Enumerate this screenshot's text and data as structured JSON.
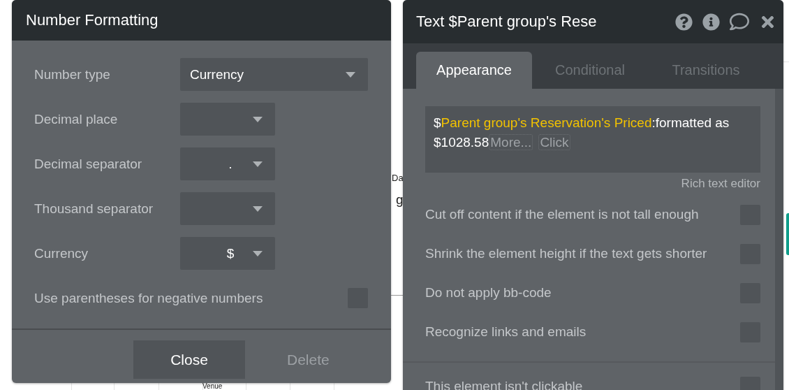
{
  "canvas": {
    "texts": [
      "Da",
      "g",
      "Venue"
    ]
  },
  "number_formatting": {
    "title": "Number Formatting",
    "fields": [
      {
        "kind": "select",
        "label": "Number type",
        "value": "Currency",
        "wide": true
      },
      {
        "kind": "select",
        "label": "Decimal place"
      },
      {
        "kind": "select",
        "label": "Decimal separator",
        "value": "."
      },
      {
        "kind": "select",
        "label": "Thousand separator"
      },
      {
        "kind": "select",
        "label": "Currency",
        "value": "$"
      },
      {
        "kind": "checkbox",
        "label": "Use parentheses for negative numbers",
        "checked": false
      }
    ],
    "buttons": [
      {
        "label": "Close",
        "disabled": false
      },
      {
        "label": "Delete",
        "disabled": true
      }
    ]
  },
  "property_editor": {
    "title": "Text $Parent group's Rese",
    "tabs": [
      {
        "label": "Appearance",
        "selected": true
      },
      {
        "label": "Conditional",
        "selected": false
      },
      {
        "label": "Transitions",
        "selected": false
      }
    ],
    "expression": {
      "segments": [
        {
          "kind": "plain",
          "text": "$"
        },
        {
          "kind": "dynamic",
          "text": "Parent group's Reservation's Priced"
        },
        {
          "kind": "plain",
          "text": ":formatted as $1028.58"
        }
      ],
      "chips": [
        "More...",
        "Click"
      ]
    },
    "rich_text_link": "Rich text editor",
    "options": [
      {
        "label": "Cut off content if the element is not tall enough",
        "checked": false
      },
      {
        "label": "Shrink the element height if the text gets shorter",
        "checked": false
      },
      {
        "label": "Do not apply bb-code",
        "checked": false
      },
      {
        "label": "Recognize links and emails",
        "checked": false
      }
    ],
    "more_options": [
      {
        "label": "This element isn't clickable",
        "checked": false
      }
    ]
  }
}
